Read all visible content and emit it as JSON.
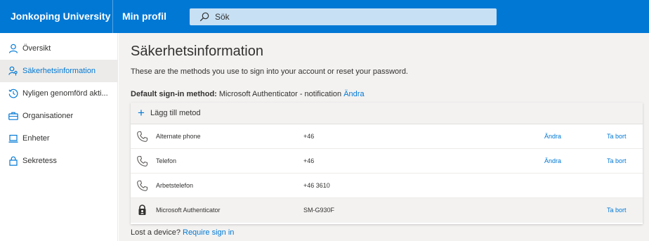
{
  "header": {
    "brand": "Jonkoping University",
    "profile": "Min profil",
    "search_placeholder": "Sök"
  },
  "sidebar": {
    "items": [
      {
        "label": "Översikt",
        "icon": "person-icon",
        "active": false
      },
      {
        "label": "Säkerhetsinformation",
        "icon": "security-info-icon",
        "active": true
      },
      {
        "label": "Nyligen genomförd akti...",
        "icon": "history-icon",
        "active": false
      },
      {
        "label": "Organisationer",
        "icon": "briefcase-icon",
        "active": false
      },
      {
        "label": "Enheter",
        "icon": "laptop-icon",
        "active": false
      },
      {
        "label": "Sekretess",
        "icon": "lock-icon",
        "active": false
      }
    ]
  },
  "main": {
    "title": "Säkerhetsinformation",
    "subtitle": "These are the methods you use to sign into your account or reset your password.",
    "default_label": "Default sign-in method:",
    "default_value": "Microsoft Authenticator - notification",
    "default_change": "Ändra",
    "add_method": "Lägg till metod",
    "methods": [
      {
        "name": "Alternate phone",
        "value": "+46",
        "change": "Ändra",
        "remove": "Ta bort",
        "icon": "phone-icon"
      },
      {
        "name": "Telefon",
        "value": "+46",
        "change": "Ändra",
        "remove": "Ta bort",
        "icon": "phone-icon"
      },
      {
        "name": "Arbetstelefon",
        "value": "+46 3610",
        "change": "",
        "remove": "",
        "icon": "phone-icon"
      },
      {
        "name": "Microsoft Authenticator",
        "value": "SM-G930F",
        "change": "",
        "remove": "Ta bort",
        "icon": "authenticator-icon"
      }
    ],
    "lost_text": "Lost a device?",
    "lost_link": "Require sign in"
  },
  "colors": {
    "accent": "#0078d4",
    "search_bg": "#c7e0f4",
    "page_bg": "#f3f2f1"
  }
}
